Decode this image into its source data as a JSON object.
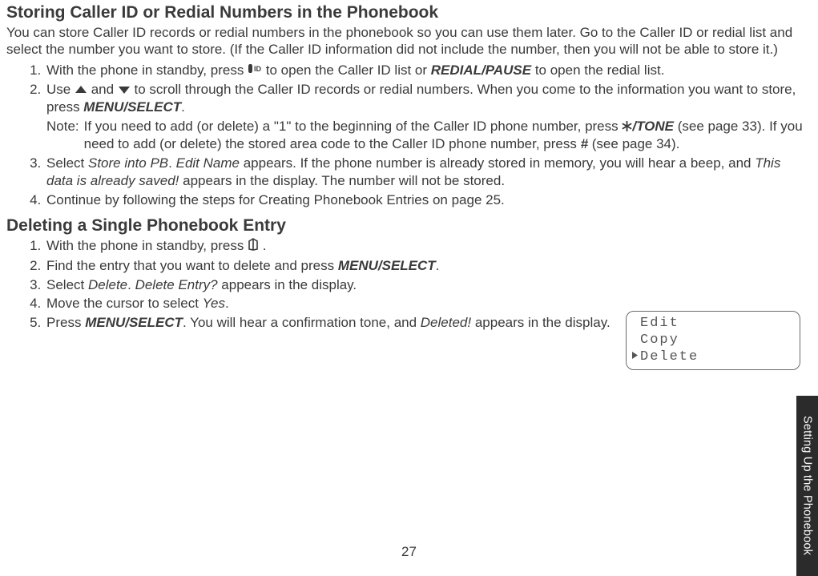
{
  "section1": {
    "title": "Storing Caller ID or Redial Numbers in the Phonebook",
    "intro": "You can store Caller ID records or redial numbers in the phonebook so you can use them later. Go to the Caller ID or redial list and select the number you want to store. (If the Caller ID information did not include the number, then you will not be able to store it.)",
    "step1_a": "With the phone in standby, press ",
    "step1_b": " to open the Caller ID list or ",
    "step1_c": "REDIAL/PAUSE",
    "step1_d": " to open the redial list.",
    "step2_a": "Use ",
    "step2_b": " and ",
    "step2_c": " to scroll through the Caller ID records or redial numbers. When you come to the information you want to store, press ",
    "step2_d": "MENU/SELECT",
    "step2_e": ".",
    "note_label": "Note:",
    "note_a": "If you need to add (or delete) a \"1\" to the beginning of the Caller ID phone number, press ",
    "note_b": "/TONE",
    "note_c": " (see page 33). If you need to add (or delete) the stored area code to the Caller ID phone number, press ",
    "note_d": "#",
    "note_e": " (see page 34).",
    "step3_a": "Select ",
    "step3_b": "Store into PB",
    "step3_c": ". ",
    "step3_d": "Edit Name",
    "step3_e": " appears. If the phone number is already stored in memory, you will hear a beep, and ",
    "step3_f": "This data is already saved!",
    "step3_g": " appears in the display. The number will not be stored.",
    "step4": "Continue by following the steps for Creating Phonebook Entries on page 25."
  },
  "section2": {
    "title": "Deleting a Single Phonebook Entry",
    "step1_a": "With the phone in standby, press  ",
    "step1_b": " .",
    "step2_a": "Find the entry that you want to delete and press ",
    "step2_b": "MENU/SELECT",
    "step2_c": ".",
    "step3_a": "Select ",
    "step3_b": "Delete",
    "step3_c": ". ",
    "step3_d": "Delete Entry?",
    "step3_e": " appears in the display.",
    "step4_a": "Move the cursor to select ",
    "step4_b": "Yes",
    "step4_c": ".",
    "step5_a": "Press ",
    "step5_b": "MENU/SELECT",
    "step5_c": ". You will hear a confirmation tone, and ",
    "step5_d": "Deleted!",
    "step5_e": " appears in the display."
  },
  "screen": {
    "row1": "Edit",
    "row2": "Copy",
    "row3": "Delete"
  },
  "page_number": "27",
  "side_tab": "Setting Up the Phonebook"
}
